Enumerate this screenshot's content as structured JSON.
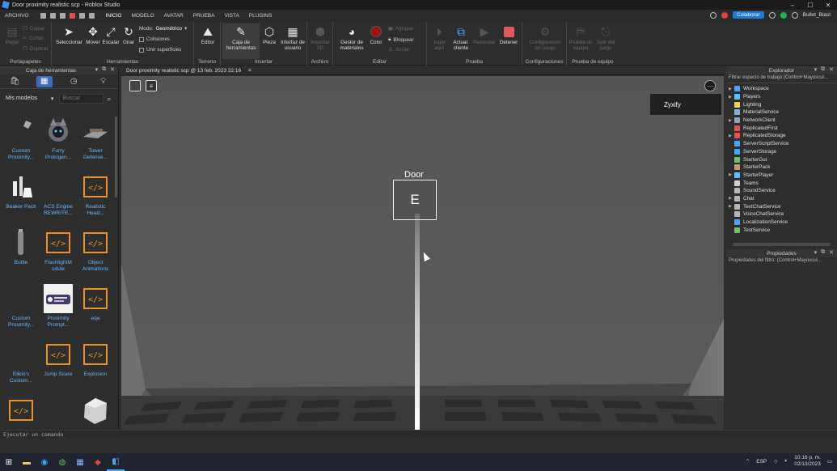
{
  "window": {
    "title": "Door proximity realistic scp - Roblox Studio"
  },
  "menubar": {
    "file": "ARCHIVO",
    "tabs": [
      "INICIO",
      "MODELO",
      "AVATAR",
      "PRUEBA",
      "VISTA",
      "PLUGINS"
    ],
    "active_tab": "INICIO",
    "collaborate": "Colaborar",
    "username": "Bullet_Blast"
  },
  "ribbon": {
    "portapapeles": {
      "label": "Portapapeles",
      "pegar": "Pegar",
      "copiar": "Copiar",
      "cortar": "Cortar",
      "duplicar": "Duplicar"
    },
    "herramientas": {
      "label": "Herramientas",
      "seleccionar": "Seleccionar",
      "mover": "Mover",
      "escalar": "Escalar",
      "girar": "Girar",
      "modo_label": "Modo:",
      "modo_value": "Geométrico",
      "colisiones": "Colisiones",
      "unir": "Unir superficies"
    },
    "terreno": {
      "label": "Terreno",
      "editor": "Editor"
    },
    "insertar": {
      "label": "Insertar",
      "caja": "Caja de herramientas",
      "pieza": "Pieza",
      "interfaz": "Interfaz de usuario"
    },
    "archivo": {
      "label": "Archivo",
      "importar": "Importar 3D"
    },
    "editar": {
      "label": "Editar",
      "gestor": "Gestor de materiales",
      "color": "Color",
      "agrupar": "Agrupar",
      "bloquear": "Bloquear",
      "anclar": "Anclar"
    },
    "prueba": {
      "label": "Prueba",
      "jugar": "Jugar aquí",
      "actualizar": "Actual. cliente",
      "reanudar": "Reanudar",
      "detener": "Detener"
    },
    "configuraciones": {
      "label": "Configuraciones",
      "config": "Configuración del juego"
    },
    "prueba_equipo": {
      "label": "Prueba de equipo",
      "prueba": "Prueba de equipo",
      "salir": "Salir del juego"
    }
  },
  "toolbox": {
    "title": "Caja de herramientas",
    "category": "Mis modelos",
    "search_placeholder": "Buscar",
    "items": [
      {
        "label": "Custom Proximity..."
      },
      {
        "label": "Furry Protogen..."
      },
      {
        "label": "Tower Defense..."
      },
      {
        "label": "Beaker Pack"
      },
      {
        "label": "ACS Engine REWRITE..."
      },
      {
        "label": "Realistic Head..."
      },
      {
        "label": "Bottle"
      },
      {
        "label": "FlashlightM odule"
      },
      {
        "label": "Object Animations"
      },
      {
        "label": "Custom Proximity..."
      },
      {
        "label": "Proximity Prompt..."
      },
      {
        "label": "eqe"
      },
      {
        "label": "Elikio's Custom..."
      },
      {
        "label": "Jump Scare"
      },
      {
        "label": "Explosion"
      },
      {
        "label": ""
      },
      {
        "label": ""
      },
      {
        "label": ""
      }
    ]
  },
  "viewport": {
    "tab_title": "Door proximity realistic scp @ 13 feb. 2023 22:16",
    "door_label": "Door",
    "prompt_key": "E",
    "player_tag": "Zyxify"
  },
  "explorer": {
    "title": "Explorador",
    "filter": "Filtrar espacio de trabajo (Control+Mayúscul...",
    "items": [
      {
        "name": "Workspace",
        "arrow": true,
        "color": "#4aa3ff"
      },
      {
        "name": "Players",
        "arrow": true,
        "color": "#5bc0ff"
      },
      {
        "name": "Lighting",
        "arrow": false,
        "color": "#f2d04a"
      },
      {
        "name": "MaterialService",
        "arrow": false,
        "color": "#7fb2e0"
      },
      {
        "name": "NetworkClient",
        "arrow": true,
        "color": "#8fa3c0"
      },
      {
        "name": "ReplicatedFirst",
        "arrow": false,
        "color": "#e05050"
      },
      {
        "name": "ReplicatedStorage",
        "arrow": true,
        "color": "#e05050"
      },
      {
        "name": "ServerScriptService",
        "arrow": false,
        "color": "#3fa9f5"
      },
      {
        "name": "ServerStorage",
        "arrow": false,
        "color": "#3fa9f5"
      },
      {
        "name": "StarterGui",
        "arrow": false,
        "color": "#6bc46b"
      },
      {
        "name": "StarterPack",
        "arrow": false,
        "color": "#c29b6b"
      },
      {
        "name": "StarterPlayer",
        "arrow": true,
        "color": "#5bc0ff"
      },
      {
        "name": "Teams",
        "arrow": false,
        "color": "#d0d0d0"
      },
      {
        "name": "SoundService",
        "arrow": false,
        "color": "#b5b5b5"
      },
      {
        "name": "Chat",
        "arrow": true,
        "color": "#b5b5b5"
      },
      {
        "name": "TextChatService",
        "arrow": true,
        "color": "#b5b5b5"
      },
      {
        "name": "VoiceChatService",
        "arrow": false,
        "color": "#b5b5b5"
      },
      {
        "name": "LocalizationService",
        "arrow": false,
        "color": "#4aa3ff"
      },
      {
        "name": "TestService",
        "arrow": false,
        "color": "#6bc46b"
      }
    ]
  },
  "properties": {
    "title": "Propiedades",
    "filter": "Propiedades del filtro: (Control+Mayúscul..."
  },
  "command_bar": {
    "placeholder": "Ejecutar un comando"
  },
  "taskbar": {
    "lang": "ESP",
    "time": "10:16 p. m.",
    "date": "02/13/2023"
  }
}
